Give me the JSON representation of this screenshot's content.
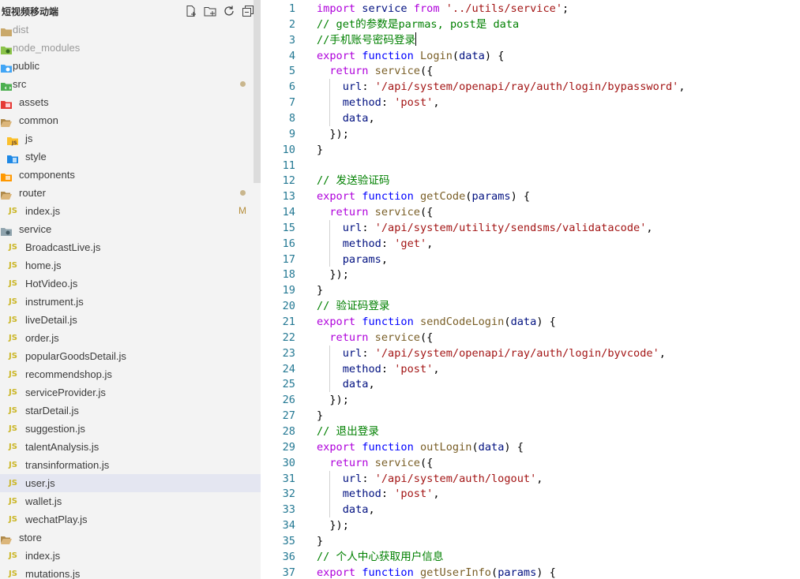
{
  "explorer": {
    "title": "短视频移动端",
    "actions": [
      "new-file-icon",
      "new-folder-icon",
      "refresh-icon",
      "collapse-all-icon"
    ],
    "items": [
      {
        "label": "dist",
        "icon": "folder-icon",
        "indent": 0,
        "faded": true
      },
      {
        "label": "node_modules",
        "icon": "node-folder-icon",
        "indent": 0,
        "faded": true
      },
      {
        "label": "public",
        "icon": "public-folder-icon",
        "indent": 0
      },
      {
        "label": "src",
        "icon": "src-folder-icon",
        "indent": 0,
        "dot": true
      },
      {
        "label": "assets",
        "icon": "assets-folder-icon",
        "indent": 1
      },
      {
        "label": "common",
        "icon": "folder-open-icon",
        "indent": 1
      },
      {
        "label": "js",
        "icon": "js-folder-icon",
        "indent": 2,
        "active": true
      },
      {
        "label": "style",
        "icon": "style-folder-icon",
        "indent": 2
      },
      {
        "label": "components",
        "icon": "components-folder-icon",
        "indent": 1
      },
      {
        "label": "router",
        "icon": "folder-open-icon",
        "indent": 1,
        "dot": true
      },
      {
        "label": "index.js",
        "icon": "js-file-icon",
        "indent": 2,
        "badge": "M"
      },
      {
        "label": "service",
        "icon": "service-folder-icon",
        "indent": 1
      },
      {
        "label": "BroadcastLive.js",
        "icon": "js-file-icon",
        "indent": 2
      },
      {
        "label": "home.js",
        "icon": "js-file-icon",
        "indent": 2
      },
      {
        "label": "HotVideo.js",
        "icon": "js-file-icon",
        "indent": 2
      },
      {
        "label": "instrument.js",
        "icon": "js-file-icon",
        "indent": 2
      },
      {
        "label": "liveDetail.js",
        "icon": "js-file-icon",
        "indent": 2
      },
      {
        "label": "order.js",
        "icon": "js-file-icon",
        "indent": 2
      },
      {
        "label": "popularGoodsDetail.js",
        "icon": "js-file-icon",
        "indent": 2
      },
      {
        "label": "recommendshop.js",
        "icon": "js-file-icon",
        "indent": 2
      },
      {
        "label": "serviceProvider.js",
        "icon": "js-file-icon",
        "indent": 2
      },
      {
        "label": "starDetail.js",
        "icon": "js-file-icon",
        "indent": 2
      },
      {
        "label": "suggestion.js",
        "icon": "js-file-icon",
        "indent": 2
      },
      {
        "label": "talentAnalysis.js",
        "icon": "js-file-icon",
        "indent": 2
      },
      {
        "label": "transinformation.js",
        "icon": "js-file-icon",
        "indent": 2
      },
      {
        "label": "user.js",
        "icon": "js-file-icon",
        "indent": 2,
        "selected": true
      },
      {
        "label": "wallet.js",
        "icon": "js-file-icon",
        "indent": 2
      },
      {
        "label": "wechatPlay.js",
        "icon": "js-file-icon",
        "indent": 2
      },
      {
        "label": "store",
        "icon": "folder-open-icon",
        "indent": 1
      },
      {
        "label": "index.js",
        "icon": "js-file-icon",
        "indent": 2
      },
      {
        "label": "mutations.js",
        "icon": "js-file-icon",
        "indent": 2
      }
    ]
  },
  "colors": {
    "keyword": "#0000ff",
    "control": "#af00db",
    "string": "#a31515",
    "comment": "#008000",
    "function": "#795e26",
    "variable": "#001080",
    "plain": "#000000",
    "lineNumber": "#237893"
  },
  "editor": {
    "cursor_line": 3,
    "lines": [
      {
        "n": "1",
        "t": [
          [
            "import ",
            "control"
          ],
          [
            "service ",
            "variable"
          ],
          [
            "from ",
            "control"
          ],
          [
            "'../utils/service'",
            "string"
          ],
          [
            ";",
            "plain"
          ]
        ]
      },
      {
        "n": "2",
        "t": [
          [
            "// get的参数是parmas, post是 data",
            "comment"
          ]
        ]
      },
      {
        "n": "3",
        "t": [
          [
            "//手机账号密码登录",
            "comment"
          ]
        ]
      },
      {
        "n": "4",
        "t": [
          [
            "export ",
            "control"
          ],
          [
            "function ",
            "keyword"
          ],
          [
            "Login",
            "function"
          ],
          [
            "(",
            "plain"
          ],
          [
            "data",
            "variable"
          ],
          [
            ") {",
            "plain"
          ]
        ]
      },
      {
        "n": "5",
        "t": [
          [
            "  ",
            "plain"
          ],
          [
            "return ",
            "control"
          ],
          [
            "service",
            "function"
          ],
          [
            "({",
            "plain"
          ]
        ]
      },
      {
        "n": "6",
        "t": [
          [
            "    ",
            "plain"
          ],
          [
            "url",
            "variable"
          ],
          [
            ": ",
            "plain"
          ],
          [
            "'/api/system/openapi/ray/auth/login/bypassword'",
            "string"
          ],
          [
            ",",
            "plain"
          ]
        ]
      },
      {
        "n": "7",
        "t": [
          [
            "    ",
            "plain"
          ],
          [
            "method",
            "variable"
          ],
          [
            ": ",
            "plain"
          ],
          [
            "'post'",
            "string"
          ],
          [
            ",",
            "plain"
          ]
        ]
      },
      {
        "n": "8",
        "t": [
          [
            "    ",
            "plain"
          ],
          [
            "data",
            "variable"
          ],
          [
            ",",
            "plain"
          ]
        ]
      },
      {
        "n": "9",
        "t": [
          [
            "  });",
            "plain"
          ]
        ]
      },
      {
        "n": "10",
        "t": [
          [
            "}",
            "plain"
          ]
        ]
      },
      {
        "n": "11",
        "t": []
      },
      {
        "n": "12",
        "t": [
          [
            "// 发送验证码",
            "comment"
          ]
        ]
      },
      {
        "n": "13",
        "t": [
          [
            "export ",
            "control"
          ],
          [
            "function ",
            "keyword"
          ],
          [
            "getCode",
            "function"
          ],
          [
            "(",
            "plain"
          ],
          [
            "params",
            "variable"
          ],
          [
            ") {",
            "plain"
          ]
        ]
      },
      {
        "n": "14",
        "t": [
          [
            "  ",
            "plain"
          ],
          [
            "return ",
            "control"
          ],
          [
            "service",
            "function"
          ],
          [
            "({",
            "plain"
          ]
        ]
      },
      {
        "n": "15",
        "t": [
          [
            "    ",
            "plain"
          ],
          [
            "url",
            "variable"
          ],
          [
            ": ",
            "plain"
          ],
          [
            "'/api/system/utility/sendsms/validatacode'",
            "string"
          ],
          [
            ",",
            "plain"
          ]
        ]
      },
      {
        "n": "16",
        "t": [
          [
            "    ",
            "plain"
          ],
          [
            "method",
            "variable"
          ],
          [
            ": ",
            "plain"
          ],
          [
            "'get'",
            "string"
          ],
          [
            ",",
            "plain"
          ]
        ]
      },
      {
        "n": "17",
        "t": [
          [
            "    ",
            "plain"
          ],
          [
            "params",
            "variable"
          ],
          [
            ",",
            "plain"
          ]
        ]
      },
      {
        "n": "18",
        "t": [
          [
            "  });",
            "plain"
          ]
        ]
      },
      {
        "n": "19",
        "t": [
          [
            "}",
            "plain"
          ]
        ]
      },
      {
        "n": "20",
        "t": [
          [
            "// 验证码登录",
            "comment"
          ]
        ]
      },
      {
        "n": "21",
        "t": [
          [
            "export ",
            "control"
          ],
          [
            "function ",
            "keyword"
          ],
          [
            "sendCodeLogin",
            "function"
          ],
          [
            "(",
            "plain"
          ],
          [
            "data",
            "variable"
          ],
          [
            ") {",
            "plain"
          ]
        ]
      },
      {
        "n": "22",
        "t": [
          [
            "  ",
            "plain"
          ],
          [
            "return ",
            "control"
          ],
          [
            "service",
            "function"
          ],
          [
            "({",
            "plain"
          ]
        ]
      },
      {
        "n": "23",
        "t": [
          [
            "    ",
            "plain"
          ],
          [
            "url",
            "variable"
          ],
          [
            ": ",
            "plain"
          ],
          [
            "'/api/system/openapi/ray/auth/login/byvcode'",
            "string"
          ],
          [
            ",",
            "plain"
          ]
        ]
      },
      {
        "n": "24",
        "t": [
          [
            "    ",
            "plain"
          ],
          [
            "method",
            "variable"
          ],
          [
            ": ",
            "plain"
          ],
          [
            "'post'",
            "string"
          ],
          [
            ",",
            "plain"
          ]
        ]
      },
      {
        "n": "25",
        "t": [
          [
            "    ",
            "plain"
          ],
          [
            "data",
            "variable"
          ],
          [
            ",",
            "plain"
          ]
        ]
      },
      {
        "n": "26",
        "t": [
          [
            "  });",
            "plain"
          ]
        ]
      },
      {
        "n": "27",
        "t": [
          [
            "}",
            "plain"
          ]
        ]
      },
      {
        "n": "28",
        "t": [
          [
            "// 退出登录",
            "comment"
          ]
        ]
      },
      {
        "n": "29",
        "t": [
          [
            "export ",
            "control"
          ],
          [
            "function ",
            "keyword"
          ],
          [
            "outLogin",
            "function"
          ],
          [
            "(",
            "plain"
          ],
          [
            "data",
            "variable"
          ],
          [
            ") {",
            "plain"
          ]
        ]
      },
      {
        "n": "30",
        "t": [
          [
            "  ",
            "plain"
          ],
          [
            "return ",
            "control"
          ],
          [
            "service",
            "function"
          ],
          [
            "({",
            "plain"
          ]
        ]
      },
      {
        "n": "31",
        "t": [
          [
            "    ",
            "plain"
          ],
          [
            "url",
            "variable"
          ],
          [
            ": ",
            "plain"
          ],
          [
            "'/api/system/auth/logout'",
            "string"
          ],
          [
            ",",
            "plain"
          ]
        ]
      },
      {
        "n": "32",
        "t": [
          [
            "    ",
            "plain"
          ],
          [
            "method",
            "variable"
          ],
          [
            ": ",
            "plain"
          ],
          [
            "'post'",
            "string"
          ],
          [
            ",",
            "plain"
          ]
        ]
      },
      {
        "n": "33",
        "t": [
          [
            "    ",
            "plain"
          ],
          [
            "data",
            "variable"
          ],
          [
            ",",
            "plain"
          ]
        ]
      },
      {
        "n": "34",
        "t": [
          [
            "  });",
            "plain"
          ]
        ]
      },
      {
        "n": "35",
        "t": [
          [
            "}",
            "plain"
          ]
        ]
      },
      {
        "n": "36",
        "t": [
          [
            "// 个人中心获取用户信息",
            "comment"
          ]
        ]
      },
      {
        "n": "37",
        "t": [
          [
            "export ",
            "control"
          ],
          [
            "function ",
            "keyword"
          ],
          [
            "getUserInfo",
            "function"
          ],
          [
            "(",
            "plain"
          ],
          [
            "params",
            "variable"
          ],
          [
            ") {",
            "plain"
          ]
        ]
      }
    ]
  }
}
